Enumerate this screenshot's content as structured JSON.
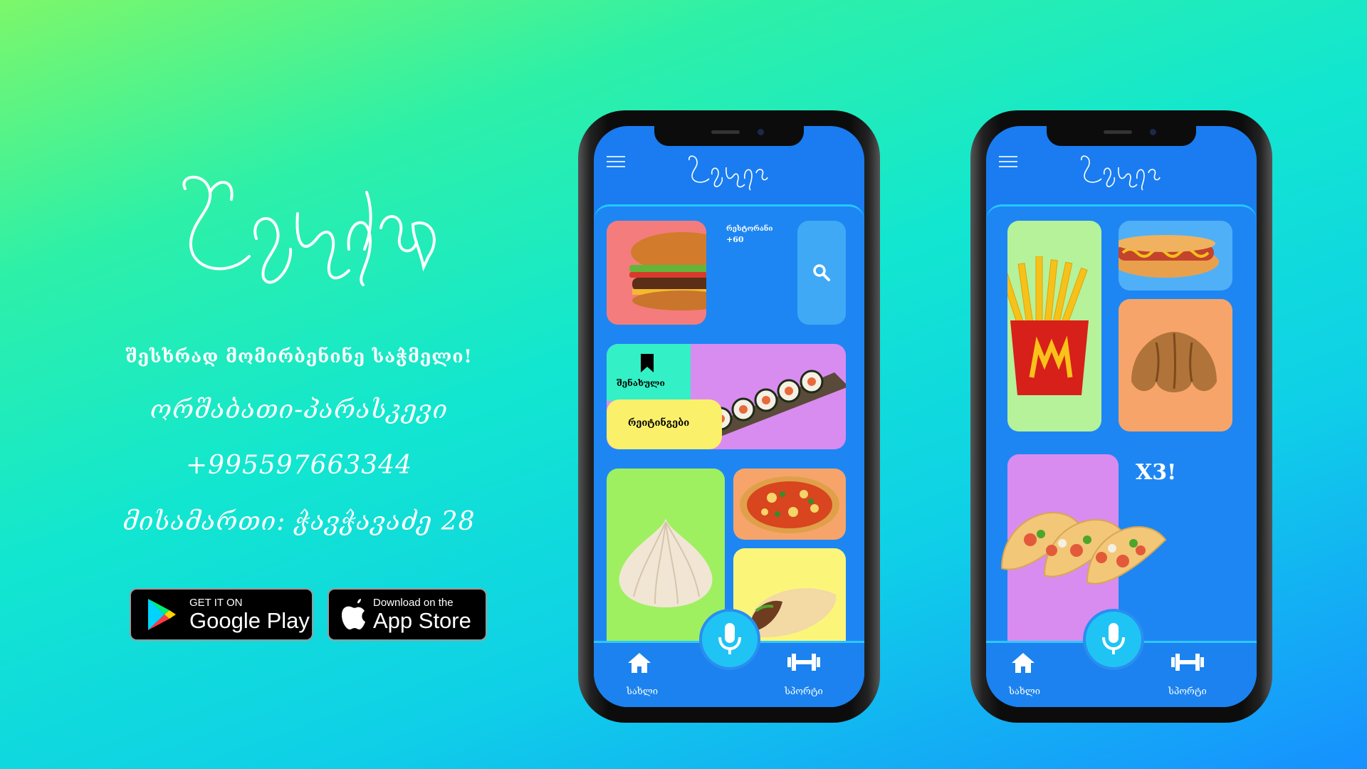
{
  "brand": {
    "tagline": "შესხრად მომირბენინე საჭმელი!",
    "days": "ორშაბათი-პარასკევი",
    "phone": "+995597663344",
    "address": "მისამართი: ჭავჭავაძე 28"
  },
  "stores": {
    "google": {
      "small": "GET IT ON",
      "big": "Google Play"
    },
    "apple": {
      "small": "Download on the",
      "big": "App Store"
    }
  },
  "phone1": {
    "restaurants_label": "რესტორანი",
    "restaurants_count": "+60",
    "saved_label": "შენახული",
    "ratings_label": "რეიტინგები",
    "nav_home": "სახლი",
    "nav_gym": "სპორტი"
  },
  "phone2": {
    "promo": "X3!",
    "nav_home": "სახლი",
    "nav_gym": "სპორტი"
  },
  "colors": {
    "screen": "#1a7cf0",
    "accent": "#23c9ff",
    "tile_red": "#f47c7c",
    "tile_purple": "#d98cf0",
    "tile_green": "#a8f077",
    "tile_orange": "#f7a46a",
    "tile_yellow": "#fbf67a"
  }
}
